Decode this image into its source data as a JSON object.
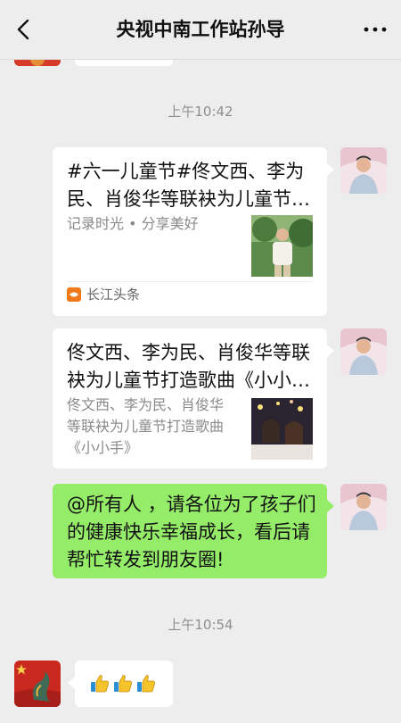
{
  "header": {
    "title": "央视中南工作站孙导"
  },
  "times": [
    "上午10:42",
    "上午10:54"
  ],
  "cards": [
    {
      "title": "#六一儿童节#佟文西、李为民、肖俊华等联袂为儿童节打造歌曲《小小手》",
      "desc": "记录时光 • 分享美好",
      "source": "长江头条"
    },
    {
      "title": "佟文西、李为民、肖俊华等联袂为儿童节打造歌曲《小小手》",
      "desc": "佟文西、李为民、肖俊华等联袂为儿童节打造歌曲《小小手》"
    }
  ],
  "message": {
    "text": "@所有人 ，请各位为了孩子们的健康快乐幸福成长，看后请帮忙转发到朋友圈!"
  },
  "emoji_message": {
    "icons": [
      "thumbs-up-icon",
      "thumbs-up-icon",
      "thumbs-up-icon"
    ]
  }
}
